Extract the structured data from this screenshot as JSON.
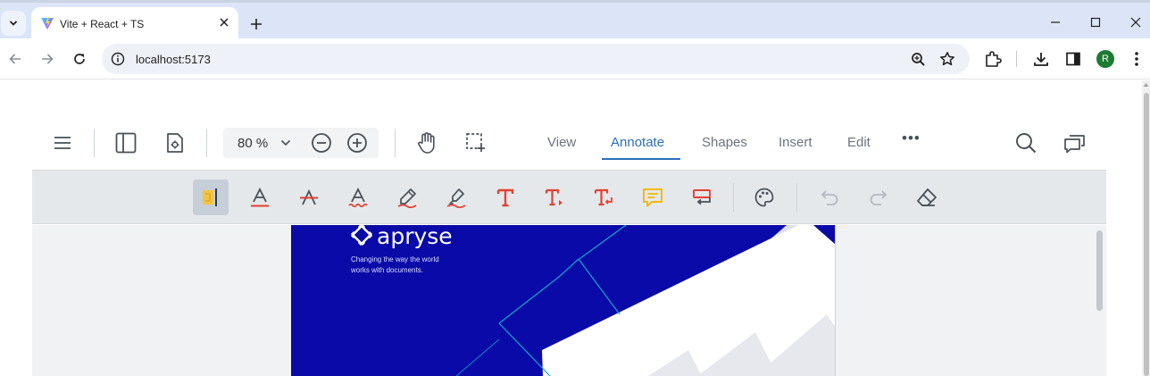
{
  "browser": {
    "tab_title": "Vite + React + TS",
    "url": "localhost:5173",
    "profile_initial": "R"
  },
  "viewer": {
    "zoom": {
      "value": "80",
      "unit": "%"
    },
    "ribbon_tabs": [
      {
        "label": "View",
        "active": false
      },
      {
        "label": "Annotate",
        "active": true
      },
      {
        "label": "Shapes",
        "active": false
      },
      {
        "label": "Insert",
        "active": false
      },
      {
        "label": "Edit",
        "active": false
      }
    ],
    "more_label": "•••"
  },
  "document": {
    "brand": "apryse",
    "tagline": "Changing the way the world works with documents."
  },
  "colors": {
    "accent_blue": "#2b6fb8",
    "tool_red": "#e44132",
    "note_yellow": "#f5b800",
    "page_blue": "#0a0aa8"
  }
}
